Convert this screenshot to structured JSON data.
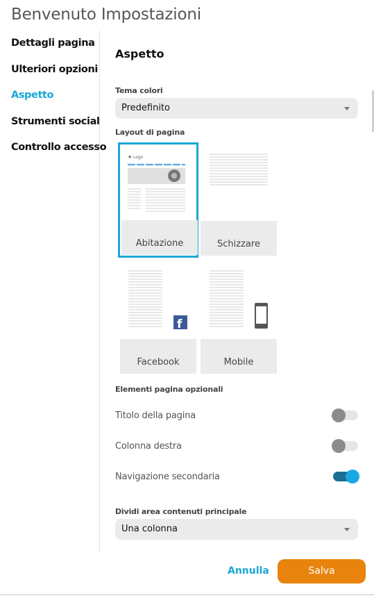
{
  "dialog": {
    "title": "Benvenuto Impostazioni"
  },
  "sidebar": {
    "items": [
      {
        "label": "Dettagli pagina",
        "active": false
      },
      {
        "label": "Ulteriori opzioni",
        "active": false
      },
      {
        "label": "Aspetto",
        "active": true
      },
      {
        "label": "Strumenti social",
        "active": false
      },
      {
        "label": "Controllo accesso",
        "active": false
      }
    ]
  },
  "main": {
    "section_title": "Aspetto",
    "theme": {
      "label": "Tema colori",
      "value": "Predefinito"
    },
    "layout": {
      "label": "Layout di pagina",
      "options": [
        {
          "label": "Abitazione",
          "selected": true,
          "logo_text": "Logo"
        },
        {
          "label": "Schizzare",
          "selected": false
        },
        {
          "label": "Facebook",
          "selected": false
        },
        {
          "label": "Mobile",
          "selected": false
        }
      ]
    },
    "optional": {
      "label": "Elementi pagina opzionali",
      "toggles": [
        {
          "label": "Titolo della pagina",
          "on": false
        },
        {
          "label": "Colonna destra",
          "on": false
        },
        {
          "label": "Navigazione secondaria",
          "on": true
        }
      ]
    },
    "split": {
      "label": "Dividi area contenuti principale",
      "value": "Una colonna"
    }
  },
  "footer": {
    "cancel_label": "Annulla",
    "save_label": "Salva"
  },
  "colors": {
    "accent": "#1aa7d6",
    "save": "#e8830e",
    "toggle_on": "#1a6f93"
  }
}
